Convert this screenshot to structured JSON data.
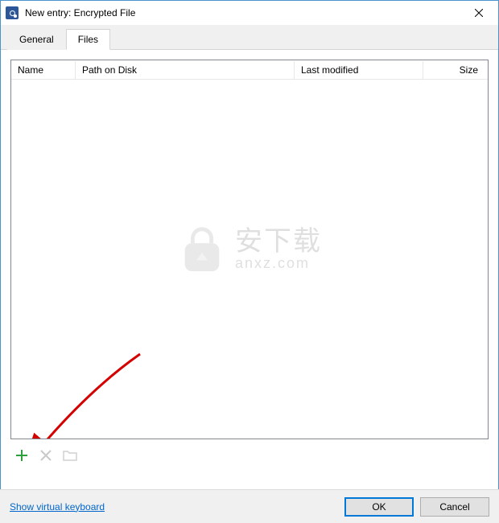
{
  "window": {
    "title": "New entry: Encrypted File"
  },
  "tabs": {
    "general": "General",
    "files": "Files"
  },
  "columns": {
    "name": "Name",
    "path": "Path on Disk",
    "modified": "Last modified",
    "size": "Size"
  },
  "watermark": {
    "cn": "安下载",
    "url": "anxz.com"
  },
  "toolbar": {
    "add_icon": "plus-icon",
    "delete_icon": "x-icon",
    "folder_icon": "folder-icon"
  },
  "footer": {
    "keyboard_link": "Show virtual keyboard",
    "ok": "OK",
    "cancel": "Cancel"
  }
}
